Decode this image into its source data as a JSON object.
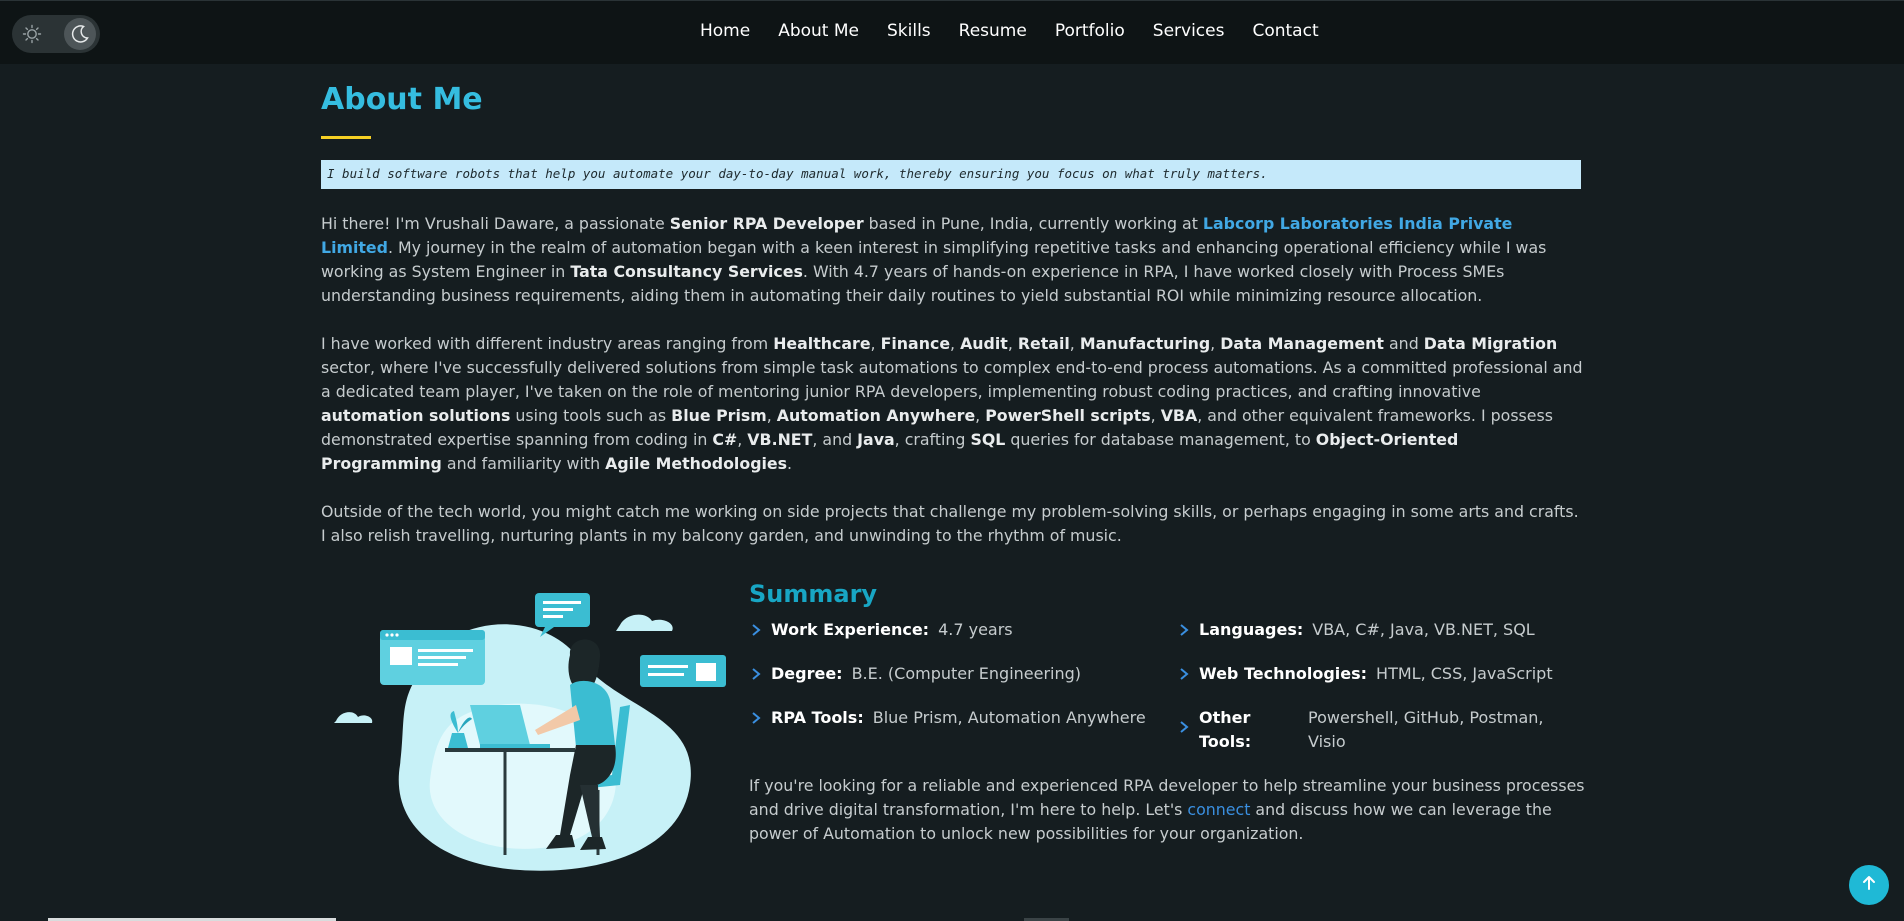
{
  "nav": {
    "items": [
      "Home",
      "About Me",
      "Skills",
      "Resume",
      "Portfolio",
      "Services",
      "Contact"
    ]
  },
  "theme_toggle": {
    "light_icon": "sun-icon",
    "dark_icon": "moon-icon",
    "active": "dark"
  },
  "about": {
    "title": "About Me",
    "quote": "I build software robots that help you automate your day-to-day manual work, thereby ensuring you focus on what truly matters.",
    "p1": {
      "t1": "Hi there! I'm Vrushali Daware, a passionate ",
      "b1": "Senior RPA Developer",
      "t2": " based in Pune, India, currently working at ",
      "link": "Labcorp Laboratories India Private Limited",
      "t3": ". My journey in the realm of automation began with a keen interest in simplifying repetitive tasks and enhancing operational efficiency while I was working as System Engineer in ",
      "b2": "Tata Consultancy Services",
      "t4": ". With 4.7 years of hands-on experience in RPA, I have worked closely with Process SMEs understanding business requirements, aiding them in automating their daily routines to yield substantial ROI while minimizing resource allocation."
    },
    "p2": {
      "t1": "I have worked with different industry areas ranging from ",
      "b1": "Healthcare",
      "s1": ", ",
      "b2": "Finance",
      "s2": ", ",
      "b3": "Audit",
      "s3": ", ",
      "b4": "Retail",
      "s4": ", ",
      "b5": "Manufacturing",
      "s5": ", ",
      "b6": "Data Management",
      "s6": " and ",
      "b7": "Data Migration",
      "t2": " sector, where I've successfully delivered solutions from simple task automations to complex end-to-end process automations. As a committed professional and a dedicated team player, I've taken on the role of mentoring junior RPA developers, implementing robust coding practices, and crafting innovative ",
      "b8": "automation solutions",
      "t3": " using tools such as ",
      "b9": "Blue Prism",
      "s7": ", ",
      "b10": "Automation Anywhere",
      "s8": ", ",
      "b11": "PowerShell scripts",
      "s9": ", ",
      "b12": "VBA",
      "t4": ", and other equivalent frameworks. I possess demonstrated expertise spanning from coding in ",
      "b13": "C#",
      "s10": ", ",
      "b14": "VB.NET",
      "s11": ", and ",
      "b15": "Java",
      "t5": ", crafting ",
      "b16": "SQL",
      "t6": " queries for database management, to ",
      "b17": "Object-Oriented Programming",
      "t7": " and familiarity with ",
      "b18": "Agile Methodologies",
      "t8": "."
    },
    "p3": "Outside of the tech world, you might catch me working on side projects that challenge my problem-solving skills, or perhaps engaging in some arts and crafts. I also relish travelling, nurturing plants in my balcony garden, and unwinding to the rhythm of music."
  },
  "summary": {
    "title": "Summary",
    "items": [
      {
        "label": "Work Experience:",
        "value": "4.7 years"
      },
      {
        "label": "Degree:",
        "value": "B.E. (Computer Engineering)"
      },
      {
        "label": "RPA Tools:",
        "value": "Blue Prism, Automation Anywhere"
      },
      {
        "label": "Languages:",
        "value": "VBA, C#, Java, VB.NET, SQL"
      },
      {
        "label": "Web Technologies:",
        "value": "HTML, CSS, JavaScript"
      },
      {
        "label": "Other Tools:",
        "value": "Powershell, GitHub, Postman, Visio"
      }
    ],
    "cta": {
      "t1": "If you're looking for a reliable and experienced RPA developer to help streamline your business processes and drive digital transformation, I'm here to help. Let's ",
      "link": "connect",
      "t2": " and discuss how we can leverage the power of Automation to unlock new possibilities for your organization."
    }
  },
  "colors": {
    "accent": "#35bde0",
    "underline": "#f6d024",
    "quote_bg": "#c5e9fa",
    "link": "#41a8e4",
    "background": "#151d20"
  },
  "scroll_top_icon": "arrow-up-icon"
}
